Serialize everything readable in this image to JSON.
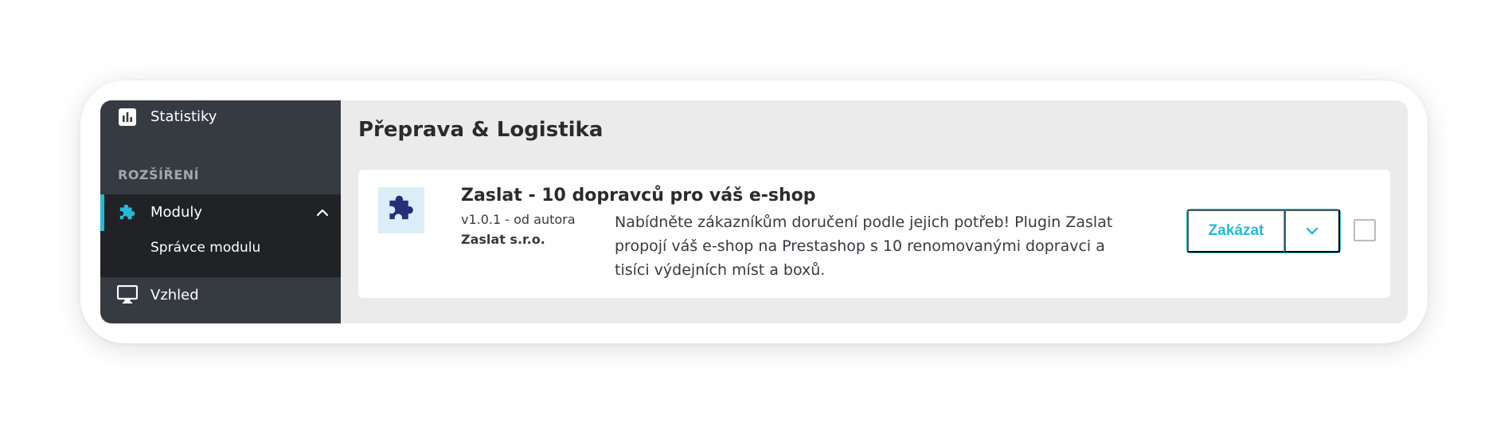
{
  "sidebar": {
    "items": [
      {
        "label": "Statistiky",
        "icon": "bar-chart-icon"
      },
      {
        "label": "Moduly",
        "icon": "puzzle-icon",
        "active": true
      },
      {
        "label": "Vzhled",
        "icon": "monitor-icon"
      }
    ],
    "section_header": "ROZŠÍŘENÍ",
    "sub_items": [
      {
        "label": "Správce modulu"
      }
    ],
    "accent_color": "#25b9d7"
  },
  "main": {
    "page_title": "Přeprava & Logistika",
    "module": {
      "name": "Zaslat - 10 dopravců pro váš e-shop",
      "version": "v1.0.1 - od autora",
      "author": "Zaslat s.r.o.",
      "description": "Nabídněte zákazníkům doručení podle jejich potřeb! Plugin Zaslat propojí váš e-shop na Prestashop s 10 renomovanými dopravci a tisíci výdejních míst a boxů.",
      "logo_icon": "puzzle-icon",
      "logo_color": "#25307a",
      "action_label": "Zakázat",
      "dropdown_icon": "chevron-down-icon"
    }
  }
}
